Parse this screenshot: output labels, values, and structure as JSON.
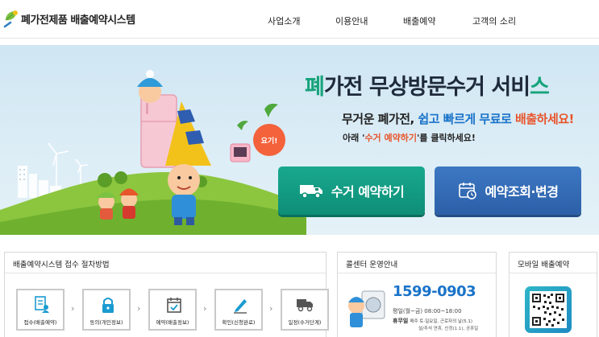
{
  "header": {
    "logo_text": "폐가전제품 배출예약시스템",
    "nav": [
      {
        "label": "사업소개"
      },
      {
        "label": "이용안내"
      },
      {
        "label": "배출예약"
      },
      {
        "label": "고객의 소리"
      }
    ]
  },
  "hero": {
    "title_lead": "폐",
    "title_mid": "가전 무상방문수거 서비",
    "title_tail": "스",
    "subtitle_1": "무거운 ",
    "subtitle_2": "폐가전",
    "subtitle_3": ", ",
    "subtitle_4": "쉽고 빠르게 무료로",
    "subtitle_5": " ",
    "subtitle_6": "배출하세요!",
    "sub2_1": "아래 '",
    "sub2_2": "수거 예약하기",
    "sub2_3": "'를 클릭하세요!",
    "speech": "요기!",
    "pickup_button": "수거 예약하기",
    "check_button": "예약조회·변경"
  },
  "process": {
    "title": "배출예약시스템 접수 절차방법",
    "steps": [
      {
        "label": "접수(배출예약)",
        "icon": "document-user-icon"
      },
      {
        "label": "동의(개인정보)",
        "icon": "lock-icon"
      },
      {
        "label": "예약(배출정보)",
        "icon": "calendar-icon"
      },
      {
        "label": "확인(신청완료)",
        "icon": "pen-icon"
      },
      {
        "label": "일정(수거단계)",
        "icon": "truck-icon"
      }
    ]
  },
  "callcenter": {
    "title": "콜센터 운영안내",
    "phone": "1599-0903",
    "weekday": "평일(월~금) 08:00~18:00",
    "holiday_label": "휴무일",
    "holiday_text": "매주 토·일요일, 근로자의 날(5.1)",
    "holiday_text2": "설/추석 연휴, 신정(1.1), 공휴일"
  },
  "mobile": {
    "title": "모바일 배출예약"
  },
  "colors": {
    "accent_green": "#16a37a",
    "accent_blue": "#1a73c9",
    "accent_orange": "#e8552b",
    "pickup_button": "#18a98f",
    "check_button": "#3d78c3"
  }
}
